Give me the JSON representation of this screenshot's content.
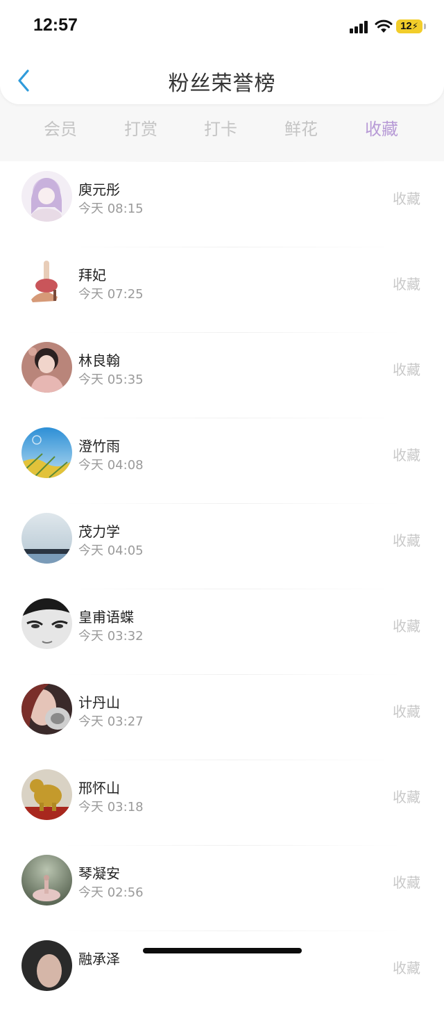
{
  "status_bar": {
    "time": "12:57",
    "battery": "12"
  },
  "header": {
    "title": "粉丝荣誉榜",
    "back_icon": "chevron-left-icon"
  },
  "tabs": [
    {
      "label": "会员",
      "active": false
    },
    {
      "label": "打赏",
      "active": false
    },
    {
      "label": "打卡",
      "active": false
    },
    {
      "label": "鲜花",
      "active": false
    },
    {
      "label": "收藏",
      "active": true
    }
  ],
  "colors": {
    "accent": "#b79ad6",
    "back_arrow": "#2f9bdb",
    "inactive_tab": "#c4c4c4",
    "secondary_text": "#9a9a9a"
  },
  "list": {
    "items": [
      {
        "name": "庾元彤",
        "time": "今天 08:15",
        "action": "收藏"
      },
      {
        "name": "拜妃",
        "time": "今天 07:25",
        "action": "收藏"
      },
      {
        "name": "林良翰",
        "time": "今天 05:35",
        "action": "收藏"
      },
      {
        "name": "澄竹雨",
        "time": "今天 04:08",
        "action": "收藏"
      },
      {
        "name": "茂力学",
        "time": "今天 04:05",
        "action": "收藏"
      },
      {
        "name": "皇甫语蝶",
        "time": "今天 03:32",
        "action": "收藏"
      },
      {
        "name": "计丹山",
        "time": "今天 03:27",
        "action": "收藏"
      },
      {
        "name": "邢怀山",
        "time": "今天 03:18",
        "action": "收藏"
      },
      {
        "name": "琴凝安",
        "time": "今天 02:56",
        "action": "收藏"
      },
      {
        "name": "融承泽",
        "time": "",
        "action": "收藏"
      }
    ]
  }
}
